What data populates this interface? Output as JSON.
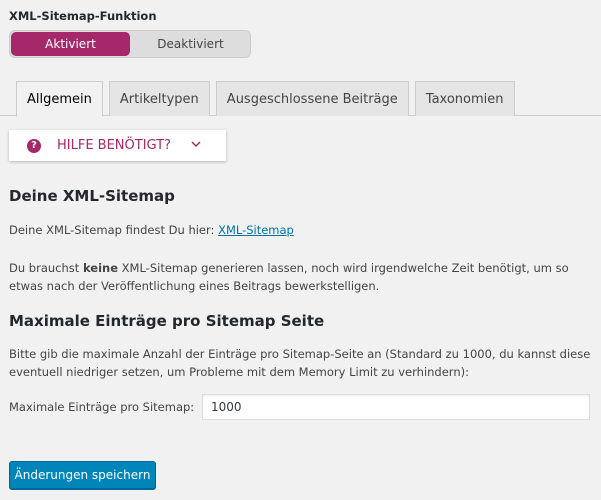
{
  "sitemap_function": {
    "label": "XML-Sitemap-Funktion",
    "options": [
      "Aktiviert",
      "Deaktiviert"
    ],
    "selected": "Aktiviert"
  },
  "tabs": [
    {
      "label": "Allgemein",
      "active": true
    },
    {
      "label": "Artikeltypen",
      "active": false
    },
    {
      "label": "Ausgeschlossene Beiträge",
      "active": false
    },
    {
      "label": "Taxonomien",
      "active": false
    }
  ],
  "help": {
    "label": "HILFE BENÖTIGT?",
    "icon": "question-circle-icon"
  },
  "your_sitemap": {
    "heading": "Deine XML-Sitemap",
    "intro": "Deine XML-Sitemap findest Du hier: ",
    "link_text": "XML-Sitemap",
    "note_before": "Du brauchst ",
    "note_bold": "keine",
    "note_after": " XML-Sitemap generieren lassen, noch wird irgendwelche Zeit benötigt, um so etwas nach der Veröffentlichung eines Beitrags bewerkstelligen."
  },
  "max_entries": {
    "heading": "Maximale Einträge pro Sitemap Seite",
    "description": "Bitte gib die maximale Anzahl der Einträge pro Sitemap-Seite an (Standard zu 1000, du kannst diese eventuell niedriger setzen, um Probleme mit dem Memory Limit zu verhindern):",
    "field_label": "Maximale Einträge pro Sitemap:",
    "field_value": "1000"
  },
  "save_button": "Änderungen speichern",
  "colors": {
    "accent": "#a4286a",
    "button": "#0085ba",
    "link": "#0073aa"
  }
}
